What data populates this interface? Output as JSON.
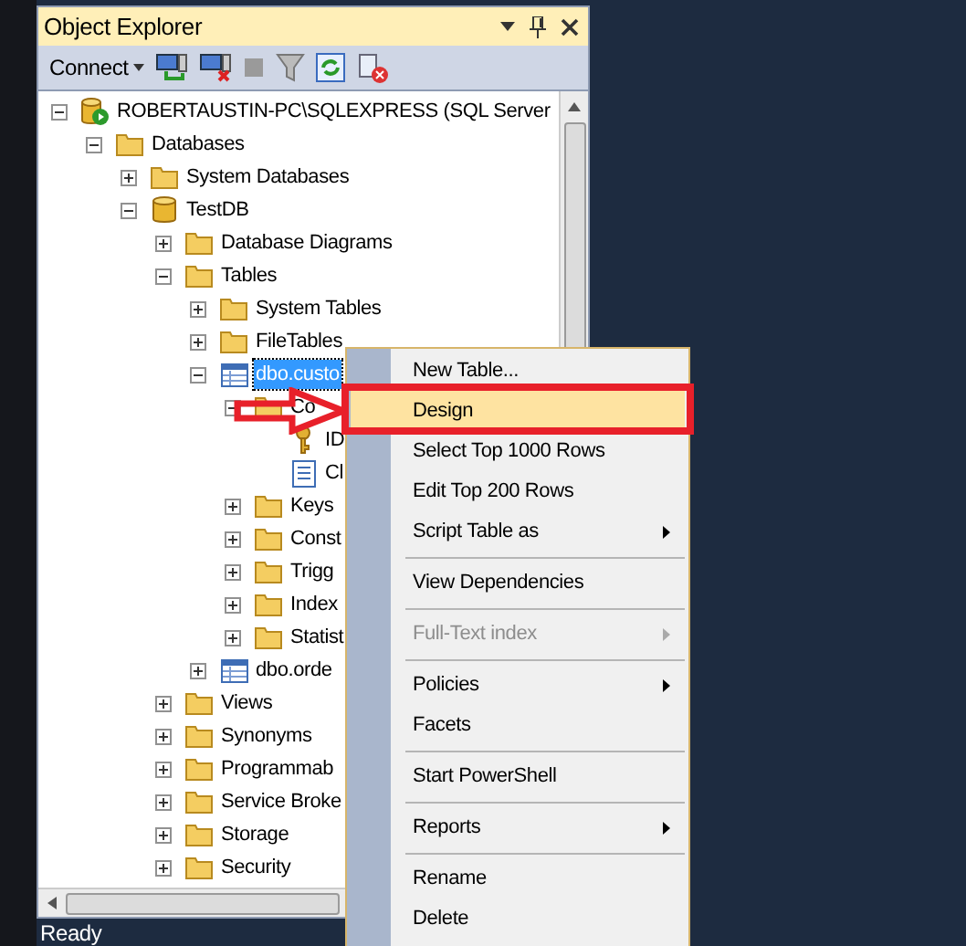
{
  "panel": {
    "title": "Object Explorer"
  },
  "toolbar": {
    "connect": "Connect"
  },
  "tree": [
    {
      "label": "ROBERTAUSTIN-PC\\SQLEXPRESS (SQL Server",
      "kind": "server",
      "expanded": true,
      "selected": false,
      "children": [
        {
          "label": "Databases",
          "kind": "folder",
          "expanded": true,
          "selected": false,
          "children": [
            {
              "label": "System Databases",
              "kind": "folder",
              "expanded": false,
              "selected": false
            },
            {
              "label": "TestDB",
              "kind": "database",
              "expanded": true,
              "selected": false,
              "children": [
                {
                  "label": "Database Diagrams",
                  "kind": "folder",
                  "expanded": false,
                  "selected": false
                },
                {
                  "label": "Tables",
                  "kind": "folder",
                  "expanded": true,
                  "selected": false,
                  "children": [
                    {
                      "label": "System Tables",
                      "kind": "folder",
                      "expanded": false,
                      "selected": false
                    },
                    {
                      "label": "FileTables",
                      "kind": "folder",
                      "expanded": false,
                      "selected": false
                    },
                    {
                      "label": "dbo.custo",
                      "kind": "table",
                      "expanded": true,
                      "selected": true,
                      "children": [
                        {
                          "label": "Co",
                          "kind": "folder",
                          "expanded": true,
                          "selected": false,
                          "children": [
                            {
                              "label": "ID",
                              "kind": "key",
                              "selected": false
                            },
                            {
                              "label": "Cl",
                              "kind": "column",
                              "selected": false
                            }
                          ]
                        },
                        {
                          "label": "Keys",
                          "kind": "folder",
                          "expanded": false,
                          "selected": false
                        },
                        {
                          "label": "Const",
                          "kind": "folder",
                          "expanded": false,
                          "selected": false
                        },
                        {
                          "label": "Trigg",
                          "kind": "folder",
                          "expanded": false,
                          "selected": false
                        },
                        {
                          "label": "Index",
                          "kind": "folder",
                          "expanded": false,
                          "selected": false
                        },
                        {
                          "label": "Statist",
                          "kind": "folder",
                          "expanded": false,
                          "selected": false
                        }
                      ]
                    },
                    {
                      "label": "dbo.orde",
                      "kind": "table",
                      "expanded": false,
                      "selected": false
                    }
                  ]
                },
                {
                  "label": "Views",
                  "kind": "folder",
                  "expanded": false,
                  "selected": false
                },
                {
                  "label": "Synonyms",
                  "kind": "folder",
                  "expanded": false,
                  "selected": false
                },
                {
                  "label": "Programmab",
                  "kind": "folder",
                  "expanded": false,
                  "selected": false
                },
                {
                  "label": "Service Broke",
                  "kind": "folder",
                  "expanded": false,
                  "selected": false
                },
                {
                  "label": "Storage",
                  "kind": "folder",
                  "expanded": false,
                  "selected": false
                },
                {
                  "label": "Security",
                  "kind": "folder",
                  "expanded": false,
                  "selected": false
                }
              ]
            }
          ]
        }
      ]
    }
  ],
  "context_menu": [
    {
      "kind": "item",
      "label": "New Table...",
      "selected": false,
      "disabled": false,
      "submenu": false
    },
    {
      "kind": "item",
      "label": "Design",
      "selected": true,
      "disabled": false,
      "submenu": false
    },
    {
      "kind": "item",
      "label": "Select Top 1000 Rows",
      "selected": false,
      "disabled": false,
      "submenu": false
    },
    {
      "kind": "item",
      "label": "Edit Top 200 Rows",
      "selected": false,
      "disabled": false,
      "submenu": false
    },
    {
      "kind": "item",
      "label": "Script Table as",
      "selected": false,
      "disabled": false,
      "submenu": true
    },
    {
      "kind": "separator"
    },
    {
      "kind": "item",
      "label": "View Dependencies",
      "selected": false,
      "disabled": false,
      "submenu": false
    },
    {
      "kind": "separator"
    },
    {
      "kind": "item",
      "label": "Full-Text index",
      "selected": false,
      "disabled": true,
      "submenu": true
    },
    {
      "kind": "separator"
    },
    {
      "kind": "item",
      "label": "Policies",
      "selected": false,
      "disabled": false,
      "submenu": true
    },
    {
      "kind": "item",
      "label": "Facets",
      "selected": false,
      "disabled": false,
      "submenu": false
    },
    {
      "kind": "separator"
    },
    {
      "kind": "item",
      "label": "Start PowerShell",
      "selected": false,
      "disabled": false,
      "submenu": false
    },
    {
      "kind": "separator"
    },
    {
      "kind": "item",
      "label": "Reports",
      "selected": false,
      "disabled": false,
      "submenu": true
    },
    {
      "kind": "separator"
    },
    {
      "kind": "item",
      "label": "Rename",
      "selected": false,
      "disabled": false,
      "submenu": false
    },
    {
      "kind": "item",
      "label": "Delete",
      "selected": false,
      "disabled": false,
      "submenu": false
    }
  ],
  "status_bar": "Ready"
}
